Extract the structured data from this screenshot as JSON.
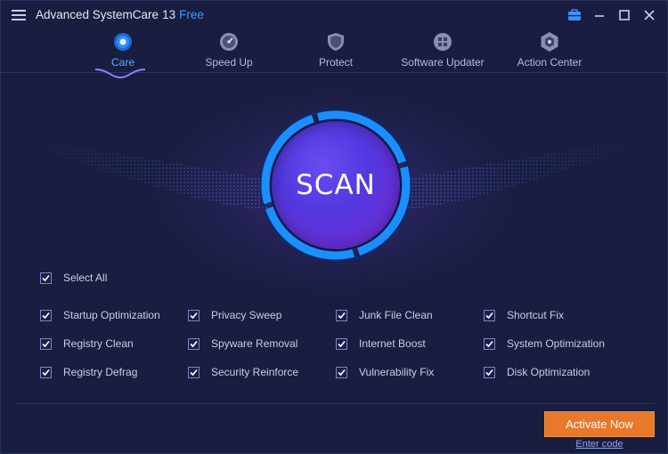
{
  "app": {
    "name": "Advanced SystemCare",
    "version": "13",
    "edition": "Free"
  },
  "nav": {
    "tabs": [
      {
        "label": "Care",
        "icon": "care-icon",
        "active": true
      },
      {
        "label": "Speed Up",
        "icon": "speedometer-icon",
        "active": false
      },
      {
        "label": "Protect",
        "icon": "shield-icon",
        "active": false
      },
      {
        "label": "Software Updater",
        "icon": "updater-icon",
        "active": false
      },
      {
        "label": "Action Center",
        "icon": "action-center-icon",
        "active": false
      }
    ]
  },
  "scan": {
    "label": "SCAN"
  },
  "options": {
    "select_all": {
      "label": "Select All",
      "checked": true
    },
    "items": [
      {
        "label": "Startup Optimization",
        "checked": true
      },
      {
        "label": "Privacy Sweep",
        "checked": true
      },
      {
        "label": "Junk File Clean",
        "checked": true
      },
      {
        "label": "Shortcut Fix",
        "checked": true
      },
      {
        "label": "Registry Clean",
        "checked": true
      },
      {
        "label": "Spyware Removal",
        "checked": true
      },
      {
        "label": "Internet Boost",
        "checked": true
      },
      {
        "label": "System Optimization",
        "checked": true
      },
      {
        "label": "Registry Defrag",
        "checked": true
      },
      {
        "label": "Security Reinforce",
        "checked": true
      },
      {
        "label": "Vulnerability Fix",
        "checked": true
      },
      {
        "label": "Disk Optimization",
        "checked": true
      }
    ]
  },
  "footer": {
    "activate_label": "Activate Now",
    "enter_code_label": "Enter code"
  },
  "colors": {
    "background": "#191d40",
    "accent_blue": "#3d9cff",
    "activate_orange": "#e8782a",
    "scan_core": "#5238e0"
  }
}
